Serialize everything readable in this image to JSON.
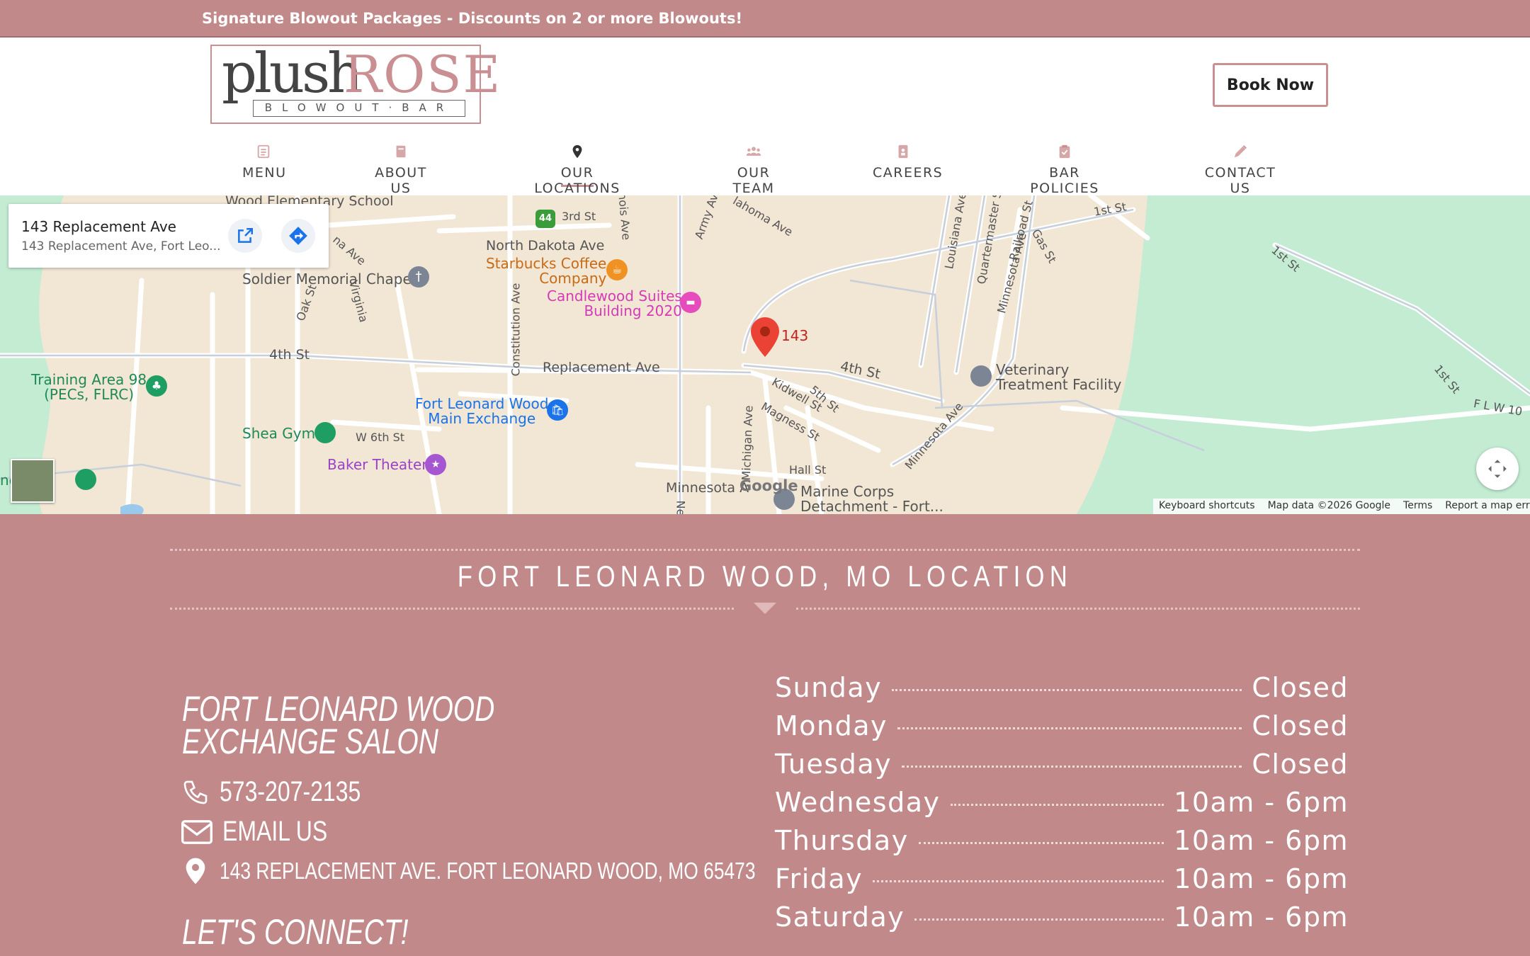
{
  "announcement": "Signature Blowout Packages - Discounts on 2 or more Blowouts!",
  "logo": {
    "plush": "plush",
    "rose": "ROSE",
    "tagline": "BLOWOUT·BAR"
  },
  "book_button": "Book Now",
  "nav": [
    {
      "label": "MENU",
      "icon": "menu-list-icon"
    },
    {
      "label": "ABOUT US",
      "icon": "book-icon"
    },
    {
      "label": "OUR LOCATIONS",
      "icon": "map-pin-icon",
      "active": true
    },
    {
      "label": "OUR TEAM",
      "icon": "users-icon"
    },
    {
      "label": "CAREERS",
      "icon": "id-badge-icon"
    },
    {
      "label": "BAR POLICIES",
      "icon": "clipboard-check-icon"
    },
    {
      "label": "CONTACT US",
      "icon": "pencil-icon"
    }
  ],
  "map": {
    "card_title": "143 Replacement Ave",
    "card_subtitle": "143 Replacement Ave, Fort Leo...",
    "marker_label": "143",
    "streets": {
      "replacement": "Replacement Ave",
      "fourth_st": "4th St",
      "fourth_st_east": "4th St",
      "north_dakota": "North Dakota Ave",
      "third_st": "3rd St",
      "constitution": "Constitution Ave",
      "oak": "Oak St",
      "virginia": "Virginia",
      "w6th": "W 6th St",
      "kidwell": "Kidwell St",
      "fifth": "5th St",
      "magness": "Magness St",
      "hall": "Hall St",
      "michigan": "Michigan Ave",
      "minnesota": "Minnesota Ave",
      "minnesota_bottom": "Minnesota A",
      "army": "Army Av",
      "oklahoma": "lahoma Ave",
      "louisiana": "Louisiana Ave",
      "quartermaster": "Quartermaster S",
      "railroad": "Railroad St",
      "gas": "Gas St",
      "minnesota_ne": "Minnesota Ave",
      "first_st": "1st St",
      "first_st_2": "1st St",
      "first_st_3": "1st St",
      "flw": "F L W 10",
      "illinois": "nois Ave",
      "na_ave": "na Ave",
      "ne": "Ne"
    },
    "pois": {
      "school": "Wood Elementary School",
      "chapel": "Soldier Memorial Chapel",
      "starbucks_1": "Starbucks Coffee",
      "starbucks_2": "Company",
      "candlewood_1": "Candlewood Suites",
      "candlewood_2": "Building 2020",
      "training_1": "Training Area 98",
      "training_2": "(PECs, FLRC)",
      "shea": "Shea Gym",
      "exchange_1": "Fort Leonard Wood",
      "exchange_2": "Main Exchange",
      "baker": "Baker Theater",
      "vet_1": "Veterinary",
      "vet_2": "Treatment Facility",
      "marine_1": "Marine Corps",
      "marine_2": "Detachment - Fort...",
      "nd": "nd"
    },
    "google": "Google",
    "attribution": [
      "Keyboard shortcuts",
      "Map data ©2026 Google",
      "Terms",
      "Report a map error"
    ],
    "shield_number": "44"
  },
  "location_title": "FORT LEONARD WOOD, MO LOCATION",
  "salon_name": "FORT LEONARD WOOD EXCHANGE SALON",
  "phone": "573-207-2135",
  "email": "EMAIL US",
  "address": "143 REPLACEMENT AVE. FORT LEONARD WOOD, MO 65473",
  "connect": "LET'S CONNECT!",
  "hours": [
    {
      "day": "Sunday",
      "time": "Closed"
    },
    {
      "day": "Monday",
      "time": "Closed"
    },
    {
      "day": "Tuesday",
      "time": "Closed"
    },
    {
      "day": "Wednesday",
      "time": "10am - 6pm"
    },
    {
      "day": "Thursday",
      "time": "10am - 6pm"
    },
    {
      "day": "Friday",
      "time": "10am - 6pm"
    },
    {
      "day": "Saturday",
      "time": "10am - 6pm"
    }
  ],
  "colors": {
    "brand_rose": "#c2898a",
    "accent": "#c98f92",
    "map_land": "#f2e6d5",
    "map_park": "#c3ecd3"
  }
}
